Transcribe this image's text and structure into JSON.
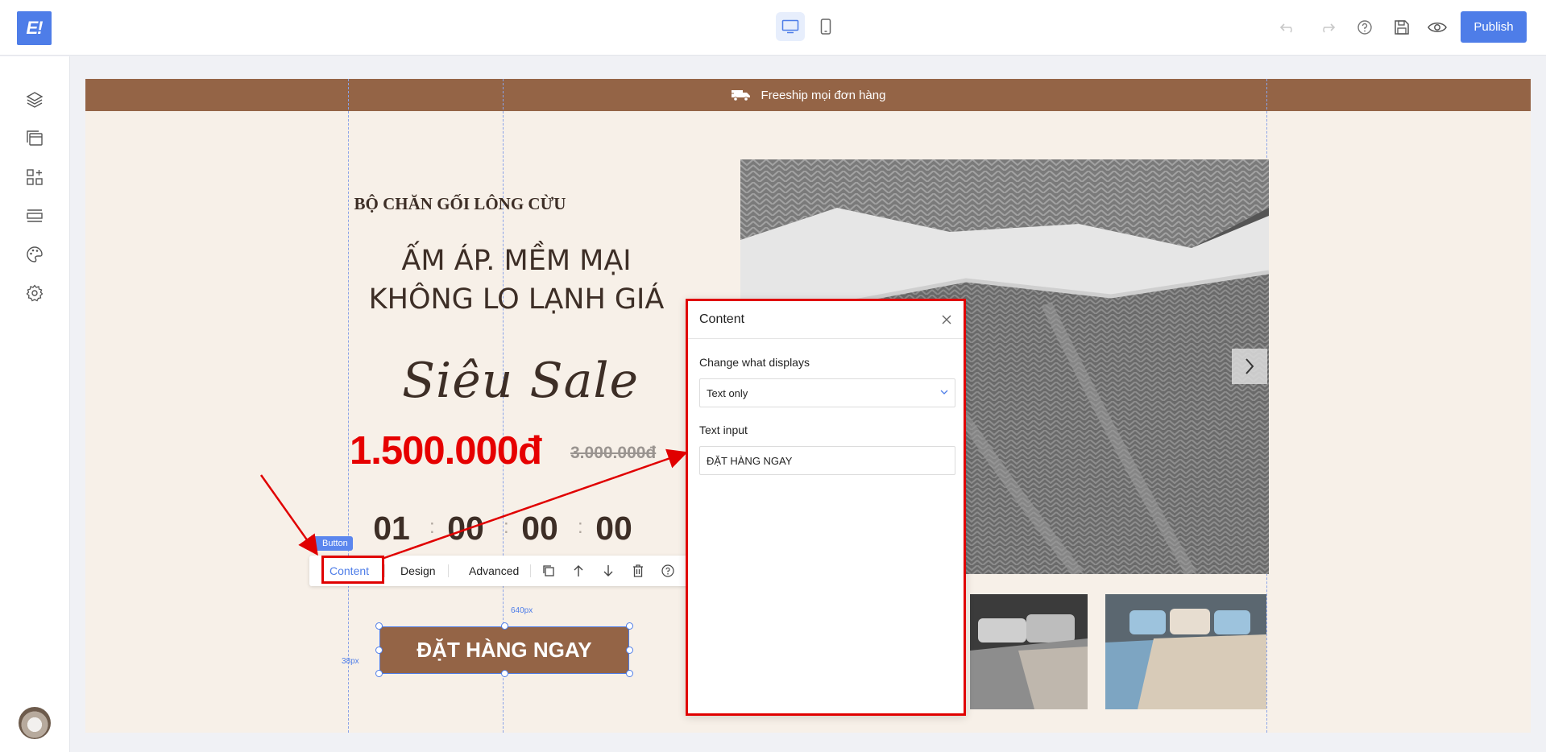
{
  "topbar": {
    "logo_text": "E!",
    "publish_label": "Publish"
  },
  "banner": {
    "text": "Freeship mọi đơn hàng"
  },
  "hero": {
    "subtitle": "BỘ CHĂN GỐI LÔNG CỪU",
    "headline_line1": "ẤM ÁP. MỀM MẠI",
    "headline_line2": "KHÔNG LO LẠNH GIÁ",
    "script_text": "Siêu Sale",
    "price": "1.500.000đ",
    "old_price": "3.000.000đ",
    "countdown": {
      "days": "01",
      "hours": "00",
      "minutes": "00",
      "seconds": "00",
      "separator": ":"
    },
    "cta_label": "ĐẶT HÀNG NGAY"
  },
  "element_toolbar": {
    "element_tag": "Button",
    "tabs": [
      "Content",
      "Design",
      "Advanced"
    ],
    "active_tab": "Content"
  },
  "dimensions": {
    "width_label": "640px",
    "height_label": "38px"
  },
  "content_panel": {
    "title": "Content",
    "display_label": "Change what displays",
    "display_value": "Text only",
    "text_input_label": "Text input",
    "text_input_value": "ĐẶT HÀNG NGAY"
  },
  "colors": {
    "accent": "#4e7de8",
    "brown": "#946446",
    "cream": "#f7f0e8",
    "price_red": "#e60000",
    "highlight_red": "#e00000"
  }
}
